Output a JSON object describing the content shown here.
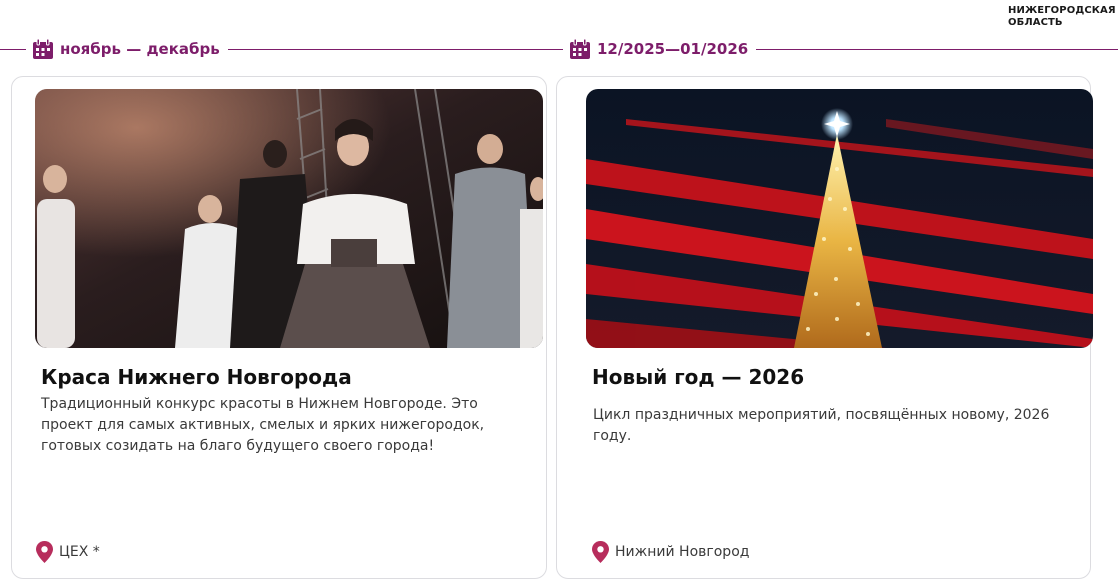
{
  "region": {
    "line1": "НИЖЕГОРОДСКАЯ",
    "line2": "ОБЛАСТЬ"
  },
  "accent_color": "#7d1d6a",
  "pin_color": "#b72d5c",
  "events": [
    {
      "date_label": "ноябрь — декабрь",
      "title": "Краса Нижнего Новгорода",
      "description": "Традиционный конкурс красоты в Нижнем Новгороде. Это проект для самых активных, смелых и ярких нижегородок, готовых созидать на благо будущего своего города!",
      "location": "ЦЕХ *",
      "image_icon": "fashion-show-photo"
    },
    {
      "date_label": "12/2025—01/2026",
      "title": "Новый год — 2026",
      "description": "Цикл праздничных мероприятий, посвящённых новому, 2026 году.",
      "location": "Нижний Новгород",
      "image_icon": "christmas-tree-photo"
    }
  ],
  "icons": {
    "calendar": "calendar-icon",
    "location": "location-pin-icon"
  }
}
